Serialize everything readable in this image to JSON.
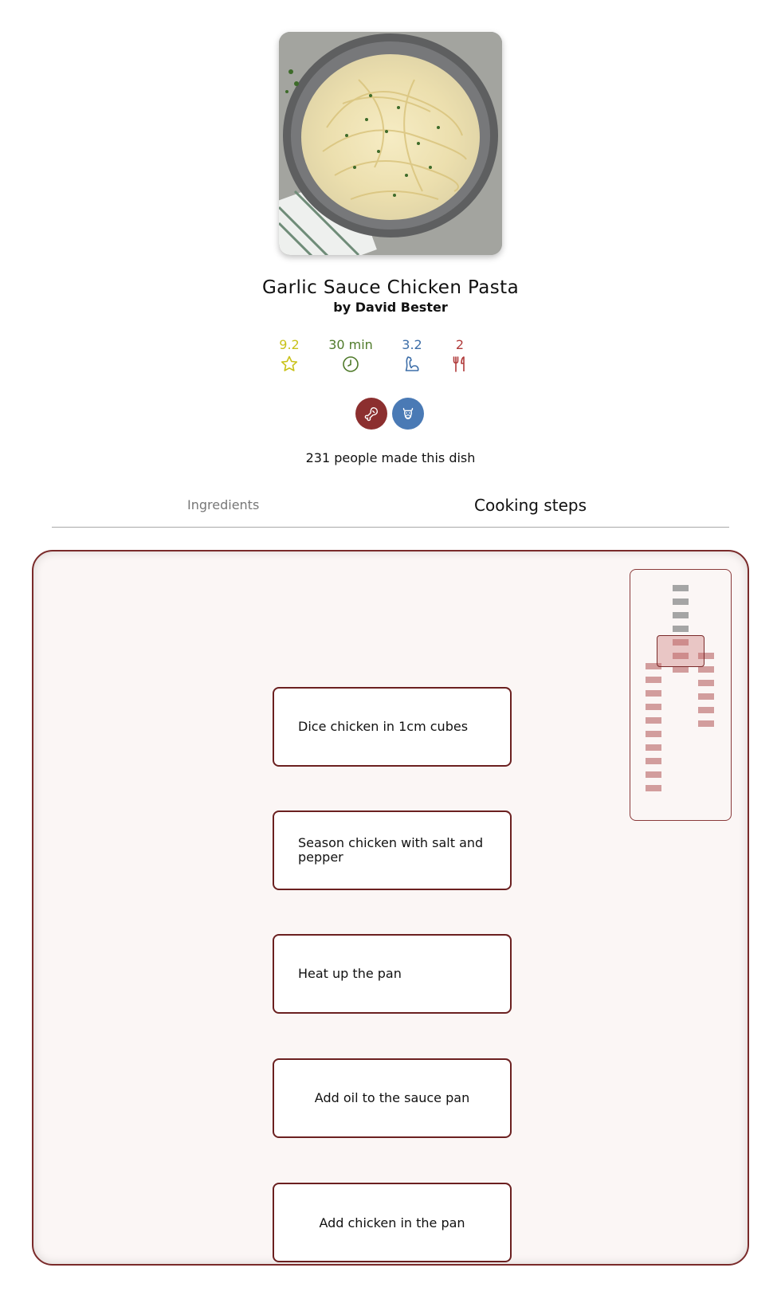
{
  "recipe": {
    "title": "Garlic Sauce Chicken Pasta",
    "author": "by David Bester",
    "image_icon": "pasta-photo"
  },
  "stats": {
    "rating": {
      "value": "9.2",
      "icon": "star-icon",
      "color": "#c9c21a"
    },
    "time": {
      "value": "30 min",
      "icon": "clock-icon",
      "color": "#4f7a2a"
    },
    "difficulty": {
      "value": "3.2",
      "icon": "flexed-arm-icon",
      "color": "#3d6ea8"
    },
    "servings": {
      "value": "2",
      "icon": "fork-knife-icon",
      "color": "#b03a3a"
    }
  },
  "badges": [
    {
      "icon": "drumstick-icon",
      "color": "#8c2f2f"
    },
    {
      "icon": "cow-icon",
      "color": "#4a7ab5"
    }
  ],
  "made_count_text": "231 people made this dish",
  "tabs": {
    "ingredients": "Ingredients",
    "cooking_steps": "Cooking steps",
    "active": "cooking_steps"
  },
  "steps": [
    "Dice chicken in 1cm cubes",
    "Season chicken with salt and pepper",
    "Heat up the pan",
    "Add oil to the sauce pan",
    "Add chicken in the pan"
  ],
  "colors": {
    "accent": "#7a2a2a",
    "panel_bg": "#fbf6f5",
    "minimap_done": "#a5a5a5",
    "minimap_todo": "#d29d9d"
  }
}
